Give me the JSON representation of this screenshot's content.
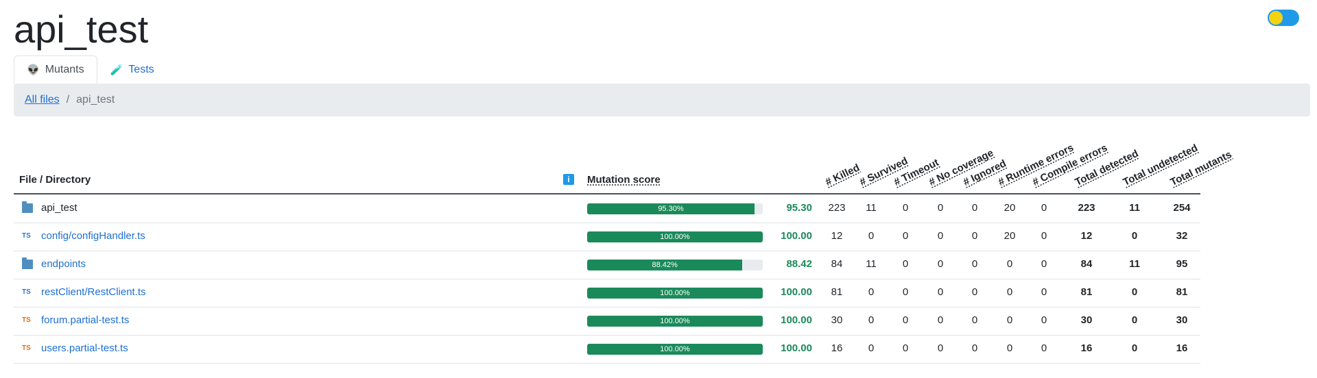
{
  "page": {
    "title": "api_test"
  },
  "tabs": [
    {
      "label": "Mutants",
      "icon": "👽"
    },
    {
      "label": "Tests",
      "icon": "🧪"
    }
  ],
  "breadcrumb": {
    "root": "All files",
    "separator": "/",
    "current": "api_test"
  },
  "table": {
    "headers": {
      "file": "File / Directory",
      "info": "i",
      "score": "Mutation score",
      "cols": [
        "# Killed",
        "# Survived",
        "# Timeout",
        "# No coverage",
        "# Ignored",
        "# Runtime errors",
        "# Compile errors",
        "Total detected",
        "Total undetected",
        "Total mutants"
      ]
    },
    "rows": [
      {
        "type": "folder",
        "icon": "folder-icon",
        "name": "api_test",
        "percent_label": "95.30%",
        "fill": 0.953,
        "score": "95.30",
        "values": [
          "223",
          "11",
          "0",
          "0",
          "0",
          "20",
          "0",
          "223",
          "11",
          "254"
        ]
      },
      {
        "type": "ts",
        "icon": "TS",
        "name": "config/configHandler.ts",
        "percent_label": "100.00%",
        "fill": 1.0,
        "score": "100.00",
        "values": [
          "12",
          "0",
          "0",
          "0",
          "0",
          "20",
          "0",
          "12",
          "0",
          "32"
        ]
      },
      {
        "type": "folder",
        "icon": "folder-icon",
        "name": "endpoints",
        "percent_label": "88.42%",
        "fill": 0.8842,
        "score": "88.42",
        "values": [
          "84",
          "11",
          "0",
          "0",
          "0",
          "0",
          "0",
          "84",
          "11",
          "95"
        ]
      },
      {
        "type": "ts",
        "icon": "TS",
        "name": "restClient/RestClient.ts",
        "percent_label": "100.00%",
        "fill": 1.0,
        "score": "100.00",
        "values": [
          "81",
          "0",
          "0",
          "0",
          "0",
          "0",
          "0",
          "81",
          "0",
          "81"
        ]
      },
      {
        "type": "test",
        "icon": "TS",
        "name": "forum.partial-test.ts",
        "percent_label": "100.00%",
        "fill": 1.0,
        "score": "100.00",
        "values": [
          "30",
          "0",
          "0",
          "0",
          "0",
          "0",
          "0",
          "30",
          "0",
          "30"
        ]
      },
      {
        "type": "test",
        "icon": "TS",
        "name": "users.partial-test.ts",
        "percent_label": "100.00%",
        "fill": 1.0,
        "score": "100.00",
        "values": [
          "16",
          "0",
          "0",
          "0",
          "0",
          "0",
          "0",
          "16",
          "0",
          "16"
        ]
      }
    ]
  },
  "colors": {
    "accent": "#1e6fd0",
    "score_green": "#1b8a5a",
    "toggle": "#1e9ae9",
    "sun": "#f4d214"
  }
}
